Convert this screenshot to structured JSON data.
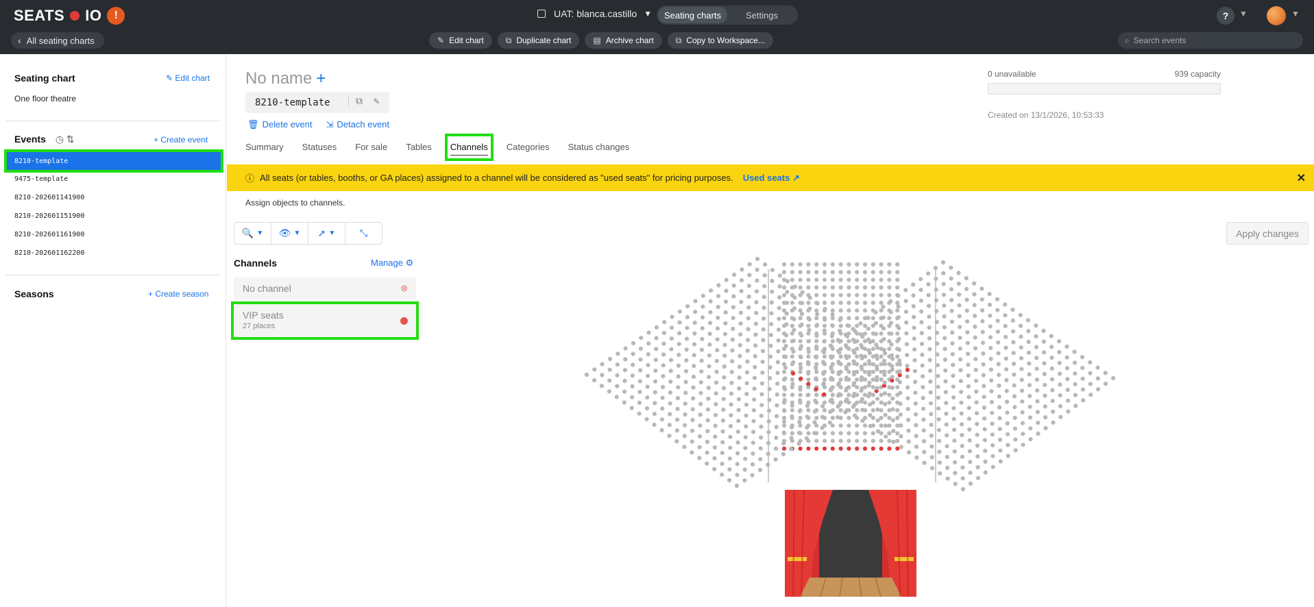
{
  "app": {
    "logo_left": "SEATS",
    "logo_right": "IO",
    "logo_warning": "!"
  },
  "header": {
    "back_label": "All seating charts",
    "workspace_label": "UAT: blanca.castillo",
    "view_tabs": [
      {
        "label": "Seating charts",
        "active": true
      },
      {
        "label": "Settings",
        "active": false
      }
    ],
    "help_label": "?",
    "toolbar": {
      "edit": "Edit chart",
      "duplicate": "Duplicate chart",
      "archive": "Archive chart",
      "copy": "Copy to Workspace..."
    },
    "search_placeholder": "Search events"
  },
  "sidebar": {
    "seating_chart_heading": "Seating chart",
    "edit_chart_link": "Edit chart",
    "chart_name": "One floor theatre",
    "events_heading": "Events",
    "create_event_link": "Create event",
    "events": [
      {
        "label": "8210-template",
        "selected": true
      },
      {
        "label": "9475-template",
        "selected": false
      },
      {
        "label": "8210-202601141900",
        "selected": false
      },
      {
        "label": "8210-202601151900",
        "selected": false
      },
      {
        "label": "8210-202601161900",
        "selected": false
      },
      {
        "label": "8210-202601162200",
        "selected": false
      }
    ],
    "seasons_heading": "Seasons",
    "create_season_link": "Create season"
  },
  "event": {
    "name": "No name",
    "key": "8210-template",
    "delete_label": "Delete event",
    "detach_label": "Detach event",
    "unavailable": "0 unavailable",
    "capacity": "939 capacity",
    "unavailable_fraction": 0,
    "created": "Created on 13/1/2026, 10:53:33"
  },
  "tabs": [
    {
      "label": "Summary",
      "active": false
    },
    {
      "label": "Statuses",
      "active": false
    },
    {
      "label": "For sale",
      "active": false
    },
    {
      "label": "Tables",
      "active": false
    },
    {
      "label": "Channels",
      "active": true
    },
    {
      "label": "Categories",
      "active": false
    },
    {
      "label": "Status changes",
      "active": false
    }
  ],
  "banner": {
    "text": "All seats (or tables, booths, or GA places) assigned to a channel will be considered as \"used seats\" for pricing purposes.",
    "link": "Used seats"
  },
  "assign_text": "Assign objects to channels.",
  "apply_label": "Apply changes",
  "channels": {
    "heading": "Channels",
    "manage_label": "Manage",
    "no_channel_label": "No channel",
    "items": [
      {
        "name": "VIP seats",
        "places": "27 places",
        "color": "#e5534b"
      }
    ]
  },
  "colors": {
    "accent": "#1a73e8",
    "banner": "#f9d40f",
    "highlight": "#22dd11",
    "seat": "#b8b8b8",
    "vip_seat": "#e23b3b"
  }
}
